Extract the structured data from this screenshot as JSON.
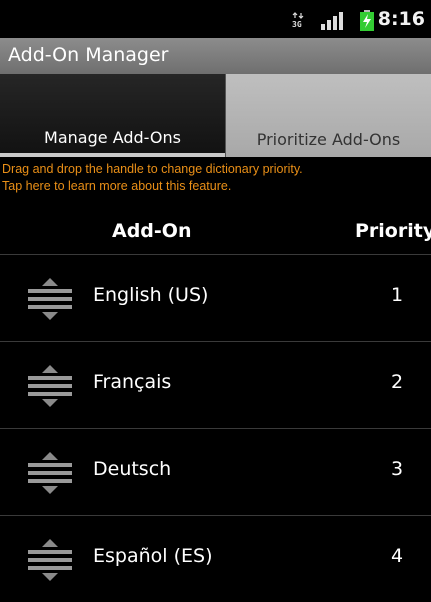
{
  "status_bar": {
    "network_type": "3G",
    "time": "8:16"
  },
  "app": {
    "title": "Add-On Manager"
  },
  "tabs": [
    {
      "label": "Manage Add-Ons",
      "selected": true
    },
    {
      "label": "Prioritize Add-Ons",
      "selected": false
    }
  ],
  "info": {
    "line1": "Drag and drop the handle to change dictionary priority.",
    "line2": "Tap here to learn more about this feature."
  },
  "table": {
    "headers": {
      "addon": "Add-On",
      "priority": "Priority"
    },
    "rows": [
      {
        "name": "English (US)",
        "priority": "1"
      },
      {
        "name": "Français",
        "priority": "2"
      },
      {
        "name": "Deutsch",
        "priority": "3"
      },
      {
        "name": "Español (ES)",
        "priority": "4"
      }
    ]
  },
  "colors": {
    "info_text": "#e98f17",
    "title_bar": "#7d7d7d",
    "battery": "#33cc33"
  },
  "icons": {
    "network": "network-3g-icon",
    "signal": "signal-strength-icon",
    "battery": "battery-charging-icon",
    "handle": "drag-handle-icon"
  }
}
